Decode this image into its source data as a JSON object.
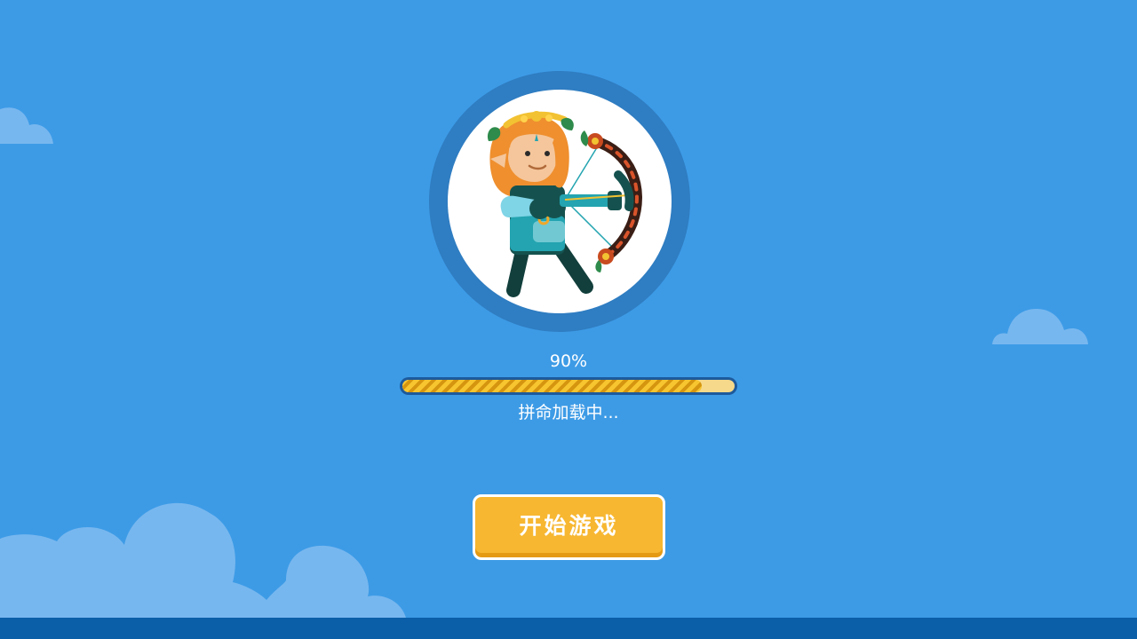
{
  "loader": {
    "progress_text": "90%",
    "progress_value": 0.9,
    "status_text": "拼命加载中..."
  },
  "actions": {
    "start_label": "开始游戏"
  },
  "colors": {
    "background": "#3d9be6",
    "cloud": "#77b7ef",
    "bottom_bar": "#0b5ea8",
    "ring": "#2f7dc2",
    "button": "#f7b731",
    "progress_fill": "#f0b323"
  },
  "icons": {
    "avatar": "elf-archer-icon"
  }
}
